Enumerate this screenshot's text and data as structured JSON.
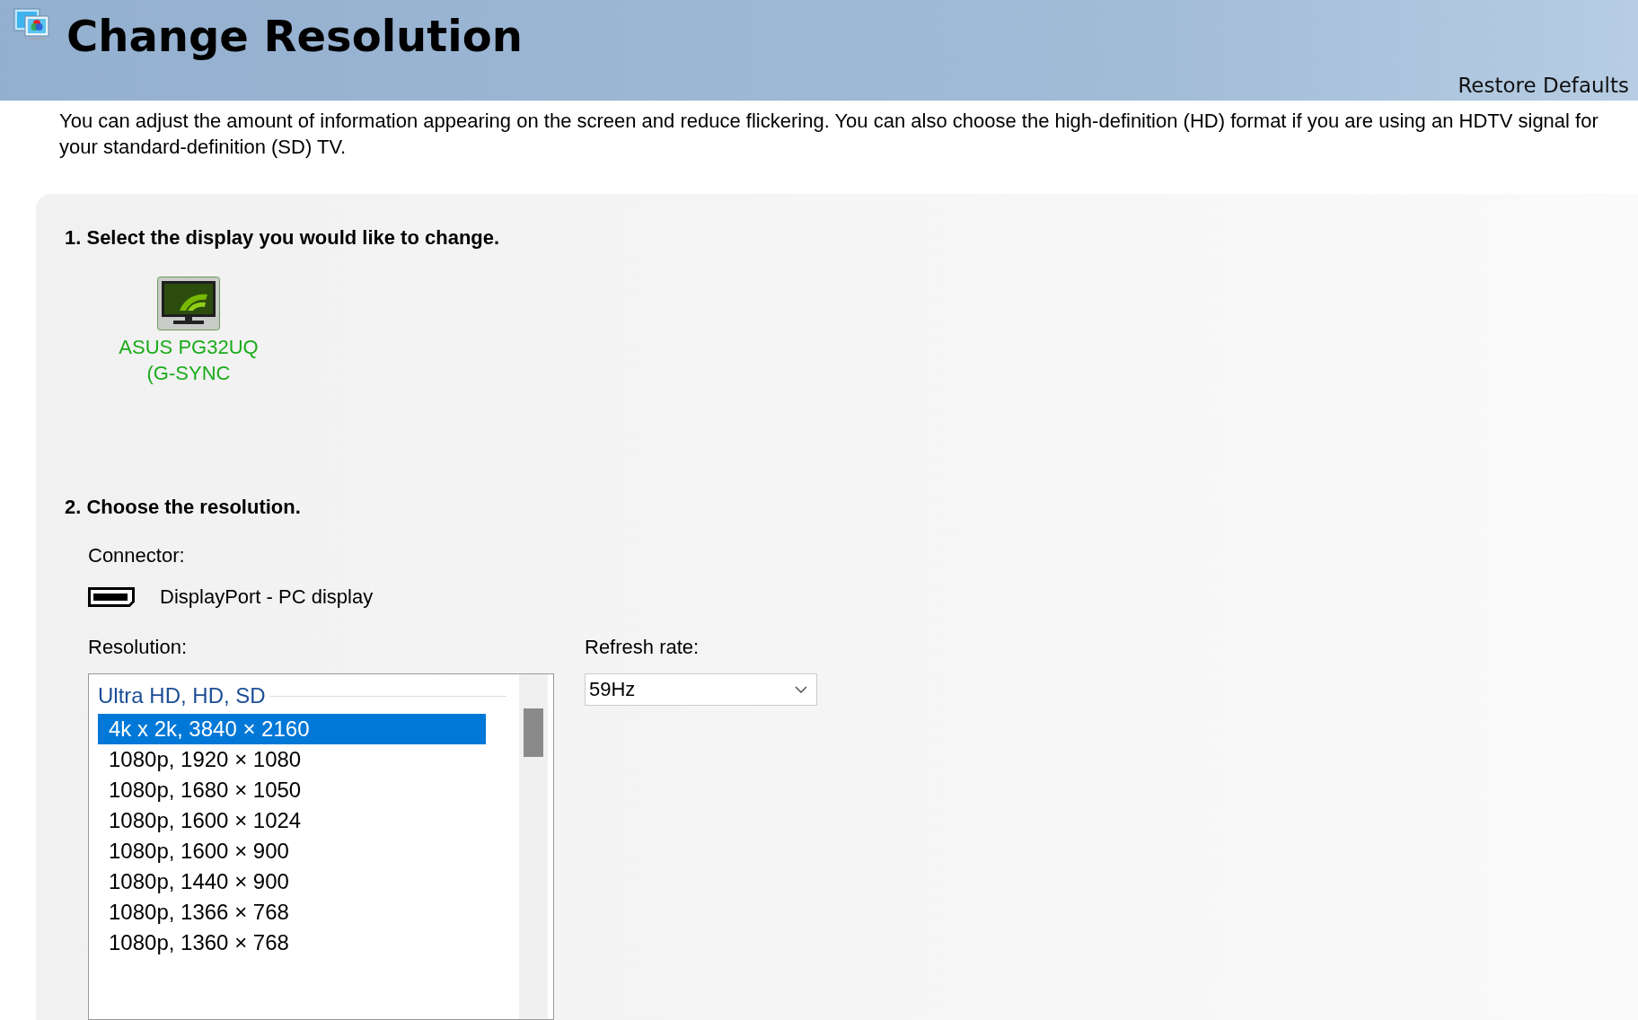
{
  "header": {
    "title": "Change Resolution",
    "restore_defaults": "Restore Defaults"
  },
  "description": "You can adjust the amount of information appearing on the screen and reduce flickering. You can also choose the high-definition (HD) format if you are using an HDTV signal for your standard-definition (SD) TV.",
  "step_1": {
    "heading": "1. Select the display you would like to change.",
    "displays": [
      {
        "label": "ASUS PG32UQ (G-SYNC",
        "selected": true
      }
    ]
  },
  "step_2": {
    "heading": "2. Choose the resolution.",
    "connector_label": "Connector:",
    "connector": "DisplayPort - PC display",
    "resolution_label": "Resolution:",
    "resolution_list": {
      "group": "Ultra HD, HD, SD",
      "items": [
        {
          "label": "4k x 2k, 3840 × 2160",
          "selected": true
        },
        {
          "label": "1080p, 1920 × 1080",
          "selected": false
        },
        {
          "label": "1080p, 1680 × 1050",
          "selected": false
        },
        {
          "label": "1080p, 1600 × 1024",
          "selected": false
        },
        {
          "label": "1080p, 1600 × 900",
          "selected": false
        },
        {
          "label": "1080p, 1440 × 900",
          "selected": false
        },
        {
          "label": "1080p, 1366 × 768",
          "selected": false
        },
        {
          "label": "1080p, 1360 × 768",
          "selected": false
        }
      ]
    },
    "refresh_rate_label": "Refresh rate:",
    "refresh_rate": "59Hz"
  }
}
